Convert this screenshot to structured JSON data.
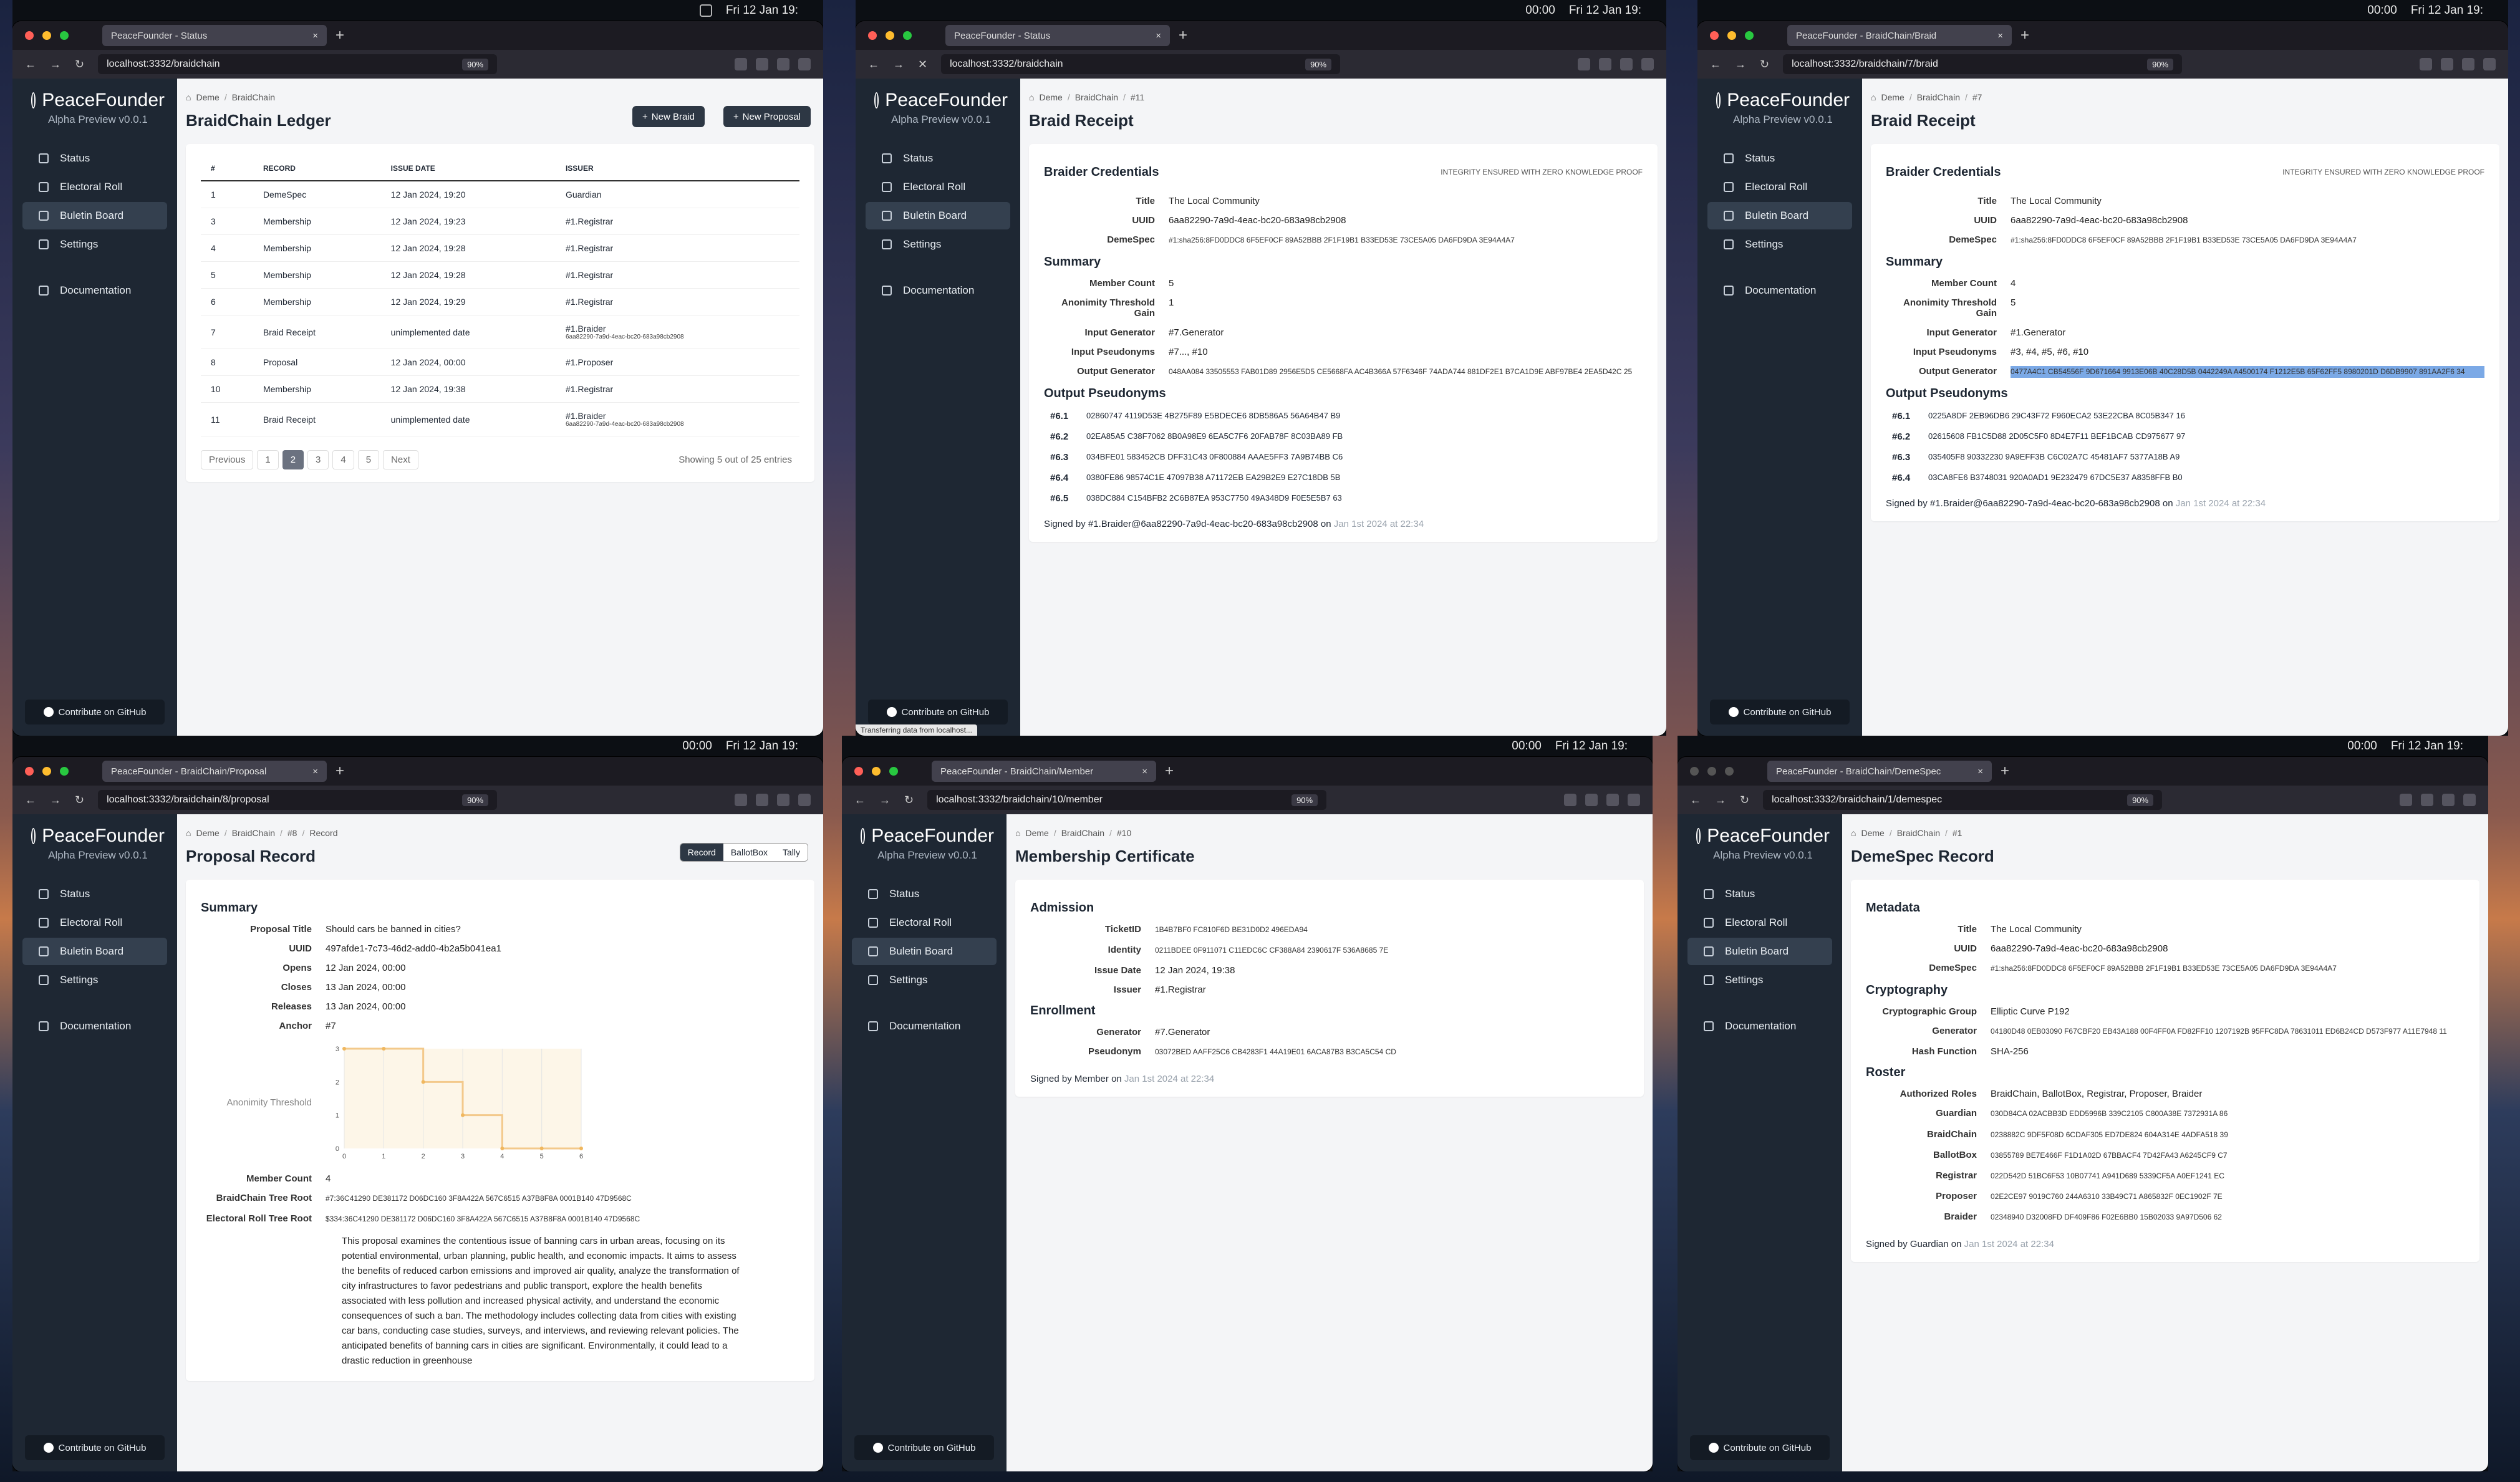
{
  "menubar": {
    "clock": "00:00",
    "date": "Fri 12 Jan 19:"
  },
  "app": {
    "name": "PeaceFounder",
    "version": "Alpha Preview v0.0.1",
    "nav": [
      "Status",
      "Electoral Roll",
      "Buletin Board",
      "Settings",
      "Documentation"
    ],
    "github": "Contribute on GitHub"
  },
  "p1": {
    "tab": "PeaceFounder - Status",
    "url": "localhost:3332/braidchain",
    "zoom": "90%",
    "bc": [
      "Deme",
      "BraidChain"
    ],
    "title": "BraidChain Ledger",
    "new_braid": "New Braid",
    "new_proposal": "New Proposal",
    "headers": [
      "#",
      "RECORD",
      "ISSUE DATE",
      "ISSUER"
    ],
    "rows": [
      [
        "1",
        "DemeSpec",
        "12 Jan 2024, 19:20",
        "Guardian",
        ""
      ],
      [
        "3",
        "Membership",
        "12 Jan 2024, 19:23",
        "#1.Registrar",
        ""
      ],
      [
        "4",
        "Membership",
        "12 Jan 2024, 19:28",
        "#1.Registrar",
        ""
      ],
      [
        "5",
        "Membership",
        "12 Jan 2024, 19:28",
        "#1.Registrar",
        ""
      ],
      [
        "6",
        "Membership",
        "12 Jan 2024, 19:29",
        "#1.Registrar",
        ""
      ],
      [
        "7",
        "Braid Receipt",
        "unimplemented date",
        "#1.Braider",
        "6aa82290-7a9d-4eac-bc20-683a98cb2908"
      ],
      [
        "8",
        "Proposal",
        "12 Jan 2024, 00:00",
        "#1.Proposer",
        ""
      ],
      [
        "10",
        "Membership",
        "12 Jan 2024, 19:38",
        "#1.Registrar",
        ""
      ],
      [
        "11",
        "Braid Receipt",
        "unimplemented date",
        "#1.Braider",
        "6aa82290-7a9d-4eac-bc20-683a98cb2908"
      ]
    ],
    "pager": [
      "Previous",
      "1",
      "2",
      "3",
      "4",
      "5",
      "Next"
    ],
    "showing": "Showing 5 out of 25 entries"
  },
  "p2": {
    "tab": "PeaceFounder - Status",
    "url": "localhost:3332/braidchain",
    "zoom": "90%",
    "bc": [
      "Deme",
      "BraidChain",
      "#11"
    ],
    "title": "Braid Receipt",
    "cred": "Braider Credentials",
    "integrity": "INTEGRITY ENSURED WITH ZERO KNOWLEDGE PROOF",
    "kv1": [
      [
        "Title",
        "The Local Community"
      ],
      [
        "UUID",
        "6aa82290-7a9d-4eac-bc20-683a98cb2908"
      ],
      [
        "DemeSpec",
        "#1:sha256:8FD0DDC8 6F5EF0CF 89A52BBB 2F1F19B1 B33ED53E 73CE5A05 DA6FD9DA 3E94A4A7"
      ]
    ],
    "summary": "Summary",
    "kv2": [
      [
        "Member Count",
        "5"
      ],
      [
        "Anonimity Threshold Gain",
        "1"
      ],
      [
        "Input Generator",
        "#7.Generator"
      ],
      [
        "Input Pseudonyms",
        "#7..., #10"
      ],
      [
        "Output Generator",
        "048AA084 33505553 FAB01D89 2956E5D5 CE5668FA AC4B366A 57F6346F 74ADA744 881DF2E1 B7CA1D9E ABF97BE4 2EA5D42C 25"
      ]
    ],
    "outp": "Output Pseudonyms",
    "ps": [
      [
        "#6.1",
        "02860747 4119D53E 4B275F89 E5BDECE6 8DB586A5 56A64B47 B9"
      ],
      [
        "#6.2",
        "02EA85A5 C38F7062 8B0A98E9 6EA5C7F6 20FAB78F 8C03BA89 FB"
      ],
      [
        "#6.3",
        "034BFE01 583452CB DFF31C43 0F800884 AAAE5FF3 7A9B74BB C6"
      ],
      [
        "#6.4",
        "0380FE86 98574C1E 47097B38 A71172EB EA29B2E9 E27C18DB 5B"
      ],
      [
        "#6.5",
        "038DC884 C154BFB2 2C6B87EA 953C7750 49A348D9 F0E5E5B7 63"
      ]
    ],
    "signed": "Signed by #1.Braider@6aa82290-7a9d-4eac-bc20-683a98cb2908 on",
    "date": "Jan 1st 2024 at 22:34",
    "status": "Transferring data from localhost..."
  },
  "p3": {
    "tab": "PeaceFounder - BraidChain/Braid",
    "url": "localhost:3332/braidchain/7/braid",
    "zoom": "90%",
    "bc": [
      "Deme",
      "BraidChain",
      "#7"
    ],
    "title": "Braid Receipt",
    "kv2": [
      [
        "Member Count",
        "4"
      ],
      [
        "Anonimity Threshold Gain",
        "5"
      ],
      [
        "Input Generator",
        "#1.Generator"
      ],
      [
        "Input Pseudonyms",
        "#3, #4, #5, #6, #10"
      ],
      [
        "Output Generator",
        "0477A4C1 CB54556F 9D671664 9913E06B 40C28D5B 0442249A A4500174 F1212E5B 65F62FF5 8980201D D6DB9907 891AA2F6 34"
      ]
    ],
    "ps": [
      [
        "#6.1",
        "0225A8DF 2EB96DB6 29C43F72 F960ECA2 53E22CBA 8C05B347 16"
      ],
      [
        "#6.2",
        "02615608 FB1C5D88 2D05C5F0 8D4E7F11 BEF1BCAB CD975677 97"
      ],
      [
        "#6.3",
        "035405F8 90332230 9A9EFF3B C6C02A7C 45481AF7 5377A18B A9"
      ],
      [
        "#6.4",
        "03CA8FE6 B3748031 920A0AD1 9E232479 67DC5E37 A8358FFB B0"
      ]
    ]
  },
  "p4": {
    "tab": "PeaceFounder - BraidChain/Proposal",
    "url": "localhost:3332/braidchain/8/proposal",
    "zoom": "90%",
    "bc": [
      "Deme",
      "BraidChain",
      "#8",
      "Record"
    ],
    "title": "Proposal Record",
    "seg": [
      "Record",
      "BallotBox",
      "Tally"
    ],
    "kv": [
      [
        "Proposal Title",
        "Should cars be banned in cities?"
      ],
      [
        "UUID",
        "497afde1-7c73-46d2-add0-4b2a5b041ea1"
      ],
      [
        "Opens",
        "12 Jan 2024, 00:00"
      ],
      [
        "Closes",
        "13 Jan 2024, 00:00"
      ],
      [
        "Releases",
        "13 Jan 2024, 00:00"
      ],
      [
        "Anchor",
        "#7"
      ]
    ],
    "chart_label": "Anonimity Threshold",
    "kv_b": [
      [
        "Member Count",
        "4"
      ],
      [
        "BraidChain Tree Root",
        "#7:36C41290 DE381172 D06DC160 3F8A422A 567C6515 A37B8F8A 0001B140 47D9568C"
      ],
      [
        "Electoral Roll Tree Root",
        "$334:36C41290 DE381172 D06DC160 3F8A422A 567C6515 A37B8F8A 0001B140 47D9568C"
      ]
    ],
    "desc": "This proposal examines the contentious issue of banning cars in urban areas, focusing on its potential environmental, urban planning, public health, and economic impacts. It aims to assess the benefits of reduced carbon emissions and improved air quality, analyze the transformation of city infrastructures to favor pedestrians and public transport, explore the health benefits associated with less pollution and increased physical activity, and understand the economic consequences of such a ban. The methodology includes collecting data from cities with existing car bans, conducting case studies, surveys, and interviews, and reviewing relevant policies. The anticipated benefits of banning cars in cities are significant. Environmentally, it could lead to a drastic reduction in greenhouse"
  },
  "chart_data": {
    "type": "line",
    "title": "",
    "xlabel": "",
    "ylabel": "Anonimity Threshold",
    "x": [
      0,
      1,
      2,
      3,
      4,
      5,
      6
    ],
    "y": [
      3,
      3,
      2,
      1,
      0,
      0,
      0
    ],
    "xlim": [
      0,
      6
    ],
    "ylim": [
      0,
      3
    ],
    "x_ticks": [
      "0",
      "1",
      "2",
      "3",
      "4",
      "5",
      "6"
    ],
    "y_ticks": [
      "0",
      "1",
      "2",
      "3"
    ],
    "grid": true
  },
  "p5": {
    "tab": "PeaceFounder - BraidChain/Member",
    "url": "localhost:3332/braidchain/10/member",
    "zoom": "90%",
    "bc": [
      "Deme",
      "BraidChain",
      "#10"
    ],
    "title": "Membership Certificate",
    "adm": "Admission",
    "kv": [
      [
        "TicketID",
        "1B4B7BF0 FC810F6D BE31D0D2 496EDA94"
      ],
      [
        "Identity",
        "0211BDEE 0F911071 C11EDC6C CF388A84 2390617F 536A8685 7E"
      ],
      [
        "Issue Date",
        "12 Jan 2024, 19:38"
      ],
      [
        "Issuer",
        "#1.Registrar"
      ]
    ],
    "enr": "Enrollment",
    "kv2": [
      [
        "Generator",
        "#7.Generator"
      ],
      [
        "Pseudonym",
        "03072BED AAFF25C6 CB4283F1 44A19E01 6ACA87B3 B3CA5C54 CD"
      ]
    ],
    "signed": "Signed by Member on",
    "date": "Jan 1st 2024 at 22:34"
  },
  "p6": {
    "tab": "PeaceFounder - BraidChain/DemeSpec",
    "url": "localhost:3332/braidchain/1/demespec",
    "zoom": "90%",
    "bc": [
      "Deme",
      "BraidChain",
      "#1"
    ],
    "title": "DemeSpec Record",
    "meta": "Metadata",
    "kv": [
      [
        "Title",
        "The Local Community"
      ],
      [
        "UUID",
        "6aa82290-7a9d-4eac-bc20-683a98cb2908"
      ],
      [
        "DemeSpec",
        "#1:sha256:8FD0DDC8 6F5EF0CF 89A52BBB 2F1F19B1 B33ED53E 73CE5A05 DA6FD9DA 3E94A4A7"
      ]
    ],
    "crypto": "Cryptography",
    "kv2": [
      [
        "Cryptographic Group",
        "Elliptic Curve P192"
      ],
      [
        "Generator",
        "04180D48 0EB03090 F67CBF20 EB43A188 00F4FF0A FD82FF10 1207192B 95FFC8DA 78631011 ED6B24CD D573F977 A11E7948 11"
      ],
      [
        "Hash Function",
        "SHA-256"
      ]
    ],
    "roster": "Roster",
    "kv3": [
      [
        "Authorized Roles",
        "BraidChain, BallotBox, Registrar, Proposer, Braider"
      ],
      [
        "Guardian",
        "030D84CA 02ACBB3D EDD5996B 339C2105 C800A38E 7372931A 86"
      ],
      [
        "BraidChain",
        "0238882C 9DF5F08D 6CDAF305 ED7DE824 604A314E 4ADFA518 39"
      ],
      [
        "BallotBox",
        "03855789 BE7E466F F1D1A02D 67BBACF4 7D42FA43 A6245CF9 C7"
      ],
      [
        "Registrar",
        "022D542D 51BC6F53 10B07741 A941D689 5339CF5A A0EF1241 EC"
      ],
      [
        "Proposer",
        "02E2CE97 9019C760 244A6310 33B49C71 A865832F 0EC1902F 7E"
      ],
      [
        "Braider",
        "02348940 D32008FD DF409F86 F02E6BB0 15B02033 9A97D506 62"
      ]
    ],
    "signed": "Signed by Guardian on",
    "date": "Jan 1st 2024 at 22:34"
  }
}
